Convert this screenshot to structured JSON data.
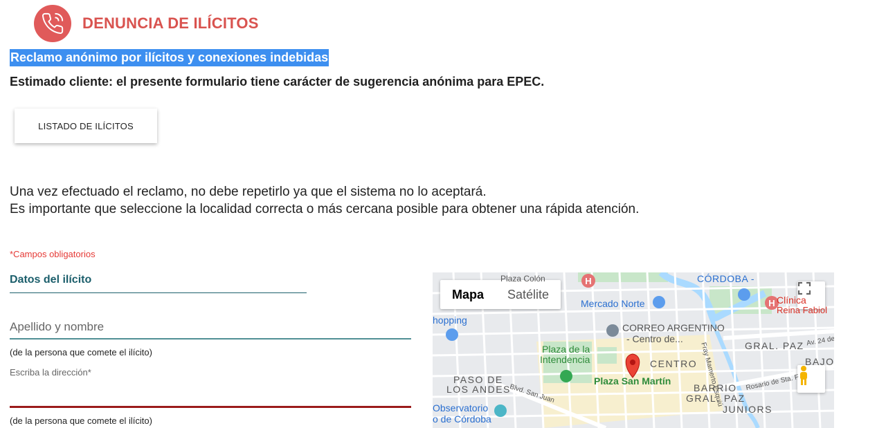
{
  "header": {
    "title": "DENUNCIA DE ILÍCITOS",
    "icon": "phone-icon",
    "icon_color": "#e05a5a"
  },
  "subtitle": "Reclamo anónimo por ilícitos y conexiones indebidas",
  "intro": "Estimado cliente: el presente formulario tiene carácter de sugerencia anónima para EPEC.",
  "list_button": "LISTADO DE ILÍCITOS",
  "info": {
    "line1": "Una vez efectuado el reclamo, no debe repetirlo ya que el sistema no lo aceptará.",
    "line2": "Es importante que seleccione la localidad correcta o más cercana posible para obtener una rápida atención."
  },
  "form": {
    "required_note": "*Campos obligatorios",
    "section_title": "Datos del ilícito",
    "name_placeholder": "Apellido y nombre",
    "name_hint": "(de la persona que comete el ilícito)",
    "address_label": "Escriba la dirección*",
    "address_hint": "(de la persona que comete el ilícito)"
  },
  "map": {
    "type_map": "Mapa",
    "type_satellite": "Satélite",
    "labels": {
      "plaza_colon": "Plaza Colón",
      "cordoba": "CÓRDOBA -",
      "mercado_norte": "Mercado Norte",
      "clinica": "Clínica",
      "clinica2": "Reina Fabiol",
      "shopping": "hopping",
      "correo": "CORREO ARGENTINO",
      "correo2": "- Centro de...",
      "fray": "Fray Mamerto Esquiú",
      "gral_paz": "GRAL. PAZ",
      "av24": "Av. 24 de",
      "plaza_intendencia": "Plaza de la",
      "plaza_intendencia2": "Intendencia",
      "centro": "CENTRO",
      "bajo": "BAJO G",
      "paso": "PASO DE",
      "los_andes": "LOS ANDES",
      "plaza_san_martin": "Plaza San Martín",
      "barrio": "BARRIO",
      "barrio2": "GRAL. PAZ",
      "rosario": "Rosario de Sta. F",
      "blvd": "Blvd. San Juan",
      "observatorio": "Observatorio",
      "observatorio2": "o de Córdoba",
      "juniors": "JUNIORS"
    }
  }
}
